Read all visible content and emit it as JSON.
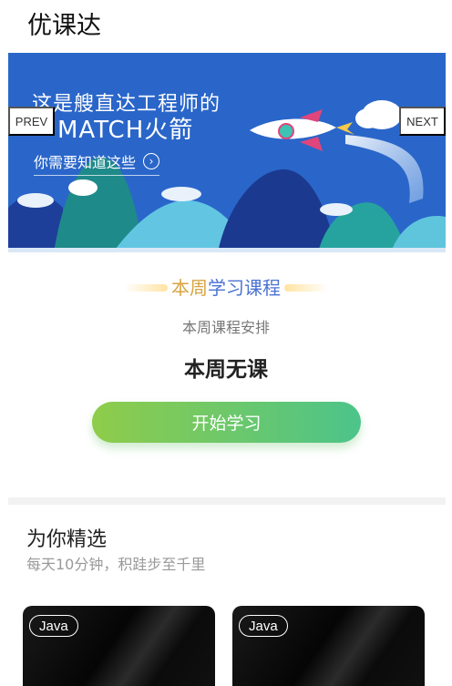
{
  "app": {
    "title": "优课达"
  },
  "banner": {
    "line1": "这是艘直达工程师的",
    "line2": "MATCH火箭",
    "link_text": "你需要知道这些",
    "link_icon": "chevron-right-circle-icon",
    "prev_label": "PREV",
    "next_label": "NEXT",
    "bg_color": "#2a66c9"
  },
  "week": {
    "heading_part1": "本周",
    "heading_part2": "学习课程",
    "subheading": "本周课程安排",
    "status": "本周无课",
    "start_button": "开始学习"
  },
  "picks": {
    "title": "为你精选",
    "subtitle": "每天10分钟，积跬步至千里",
    "cards": [
      {
        "tag": "Java"
      },
      {
        "tag": "Java"
      }
    ]
  },
  "colors": {
    "accent_gold": "#d8a440",
    "accent_blue": "#4a72d4",
    "button_start": "#8fcc4a",
    "button_end": "#4cc48a"
  }
}
